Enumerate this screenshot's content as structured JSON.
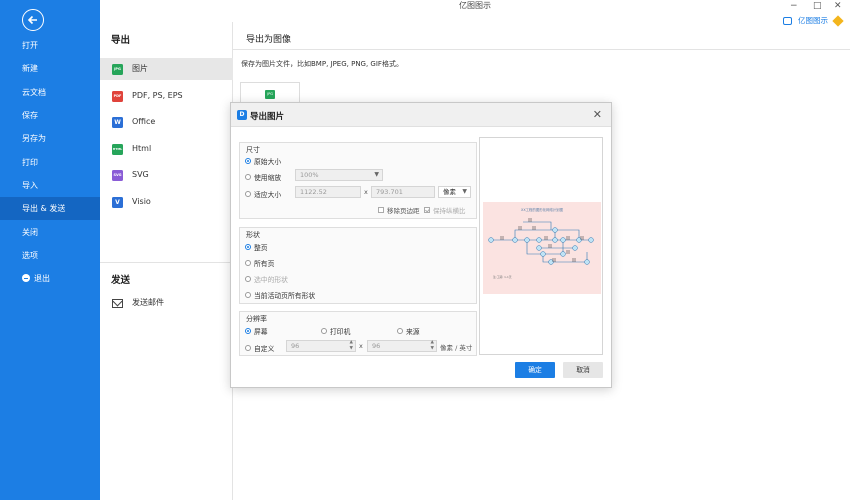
{
  "app": {
    "title": "亿图图示",
    "brand": "亿图图示",
    "brand_color": "#1c7ee4"
  },
  "window_controls": {
    "minimize": "−",
    "maximize": "□",
    "close": "✕"
  },
  "sidebar": {
    "back_icon": "arrow-left-icon",
    "items": [
      {
        "label": "打开"
      },
      {
        "label": "新建"
      },
      {
        "label": "云文档"
      },
      {
        "label": "保存"
      },
      {
        "label": "另存为"
      },
      {
        "label": "打印"
      },
      {
        "label": "导入"
      },
      {
        "label": "导出 & 发送",
        "active": true
      },
      {
        "label": "关闭"
      },
      {
        "label": "选项"
      },
      {
        "label": "退出",
        "icon": "exit-icon"
      }
    ]
  },
  "export_panel": {
    "title": "导出",
    "formats": [
      {
        "label": "图片",
        "icon_text": "JPG",
        "color": "#26a55a",
        "active": true
      },
      {
        "label": "PDF, PS, EPS",
        "icon_text": "PDF",
        "color": "#e0433b"
      },
      {
        "label": "Office",
        "icon_text": "W",
        "color": "#2b6fd6"
      },
      {
        "label": "Html",
        "icon_text": "HTML",
        "color": "#26a55a"
      },
      {
        "label": "SVG",
        "icon_text": "SVG",
        "color": "#8a5cd6"
      },
      {
        "label": "Visio",
        "icon_text": "V",
        "color": "#2b6fd6"
      }
    ],
    "send_title": "发送",
    "send_items": [
      {
        "label": "发送邮件",
        "icon": "mail-icon"
      }
    ]
  },
  "content": {
    "title": "导出为图像",
    "description": "保存为图片文件，比如BMP, JPEG, PNG, GIF格式。",
    "thumb_icon": "JPG"
  },
  "dialog": {
    "title": "导出图片",
    "logo": "D",
    "close": "✕",
    "size_group": {
      "label": "尺寸",
      "original": "原始大小",
      "use_zoom": "使用缩放",
      "zoom_value": "100%",
      "fit_size": "适应大小",
      "width": "1122.52",
      "x": "x",
      "height": "793.701",
      "unit": "像素",
      "remove_margin": "移除页边距",
      "keep_ratio": "保持纵横比"
    },
    "shape_group": {
      "label": "形状",
      "whole_page": "整页",
      "all_pages": "所有页",
      "selected_shapes": "选中的形状",
      "current_page_all": "当前活动页所有形状"
    },
    "resolution_group": {
      "label": "分辨率",
      "screen": "屏幕",
      "printer": "打印机",
      "source": "来源",
      "custom": "自定义",
      "dpi_x": "96",
      "x": "x",
      "dpi_y": "96",
      "unit": "像素 / 英寸"
    },
    "preview": {
      "title": "XX工程的图形化网络计划图",
      "note": "注:工期: 1-1天"
    },
    "ok": "确定",
    "cancel": "取消"
  }
}
